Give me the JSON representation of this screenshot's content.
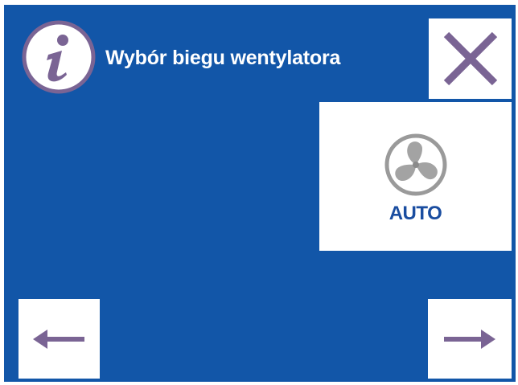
{
  "header": {
    "title": "Wybór biegu wentylatora",
    "info_icon": "info-icon"
  },
  "toolbar": {
    "close_icon": "close-icon"
  },
  "modes": [
    {
      "label": "AUTO",
      "icon": "fan-icon"
    }
  ],
  "navigation": {
    "prev_icon": "arrow-left-icon",
    "next_icon": "arrow-right-icon"
  },
  "colors": {
    "background": "#1256a8",
    "panel": "#ffffff",
    "accent_purple": "#7a6494",
    "fan_grey": "#9a9a9a",
    "label_blue": "#1a4da0"
  }
}
